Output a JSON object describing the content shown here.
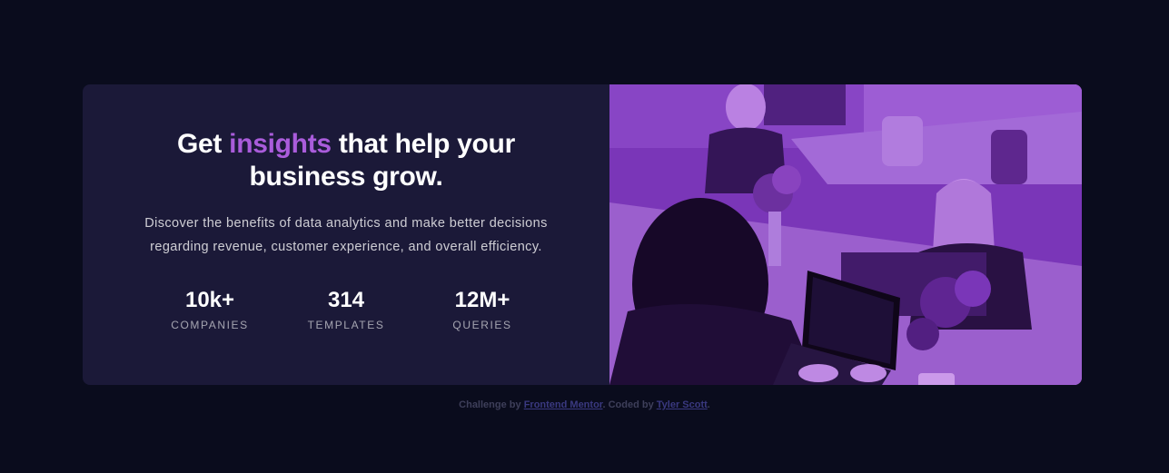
{
  "hero": {
    "title_part1": "Get ",
    "title_accent": "insights",
    "title_part2": " that help your business grow.",
    "description": "Discover the benefits of data analytics and make better decisions regarding revenue, customer experience, and overall efficiency."
  },
  "stats": [
    {
      "value": "10k+",
      "label": "COMPANIES"
    },
    {
      "value": "314",
      "label": "TEMPLATES"
    },
    {
      "value": "12M+",
      "label": "QUERIES"
    }
  ],
  "attribution": {
    "prefix": "Challenge by ",
    "link1": "Frontend Mentor",
    "middle": ". Coded by ",
    "link2": "Tyler Scott",
    "suffix": "."
  },
  "colors": {
    "background": "#0a0c1d",
    "card": "#1b1938",
    "accent": "#aa5cdb"
  }
}
